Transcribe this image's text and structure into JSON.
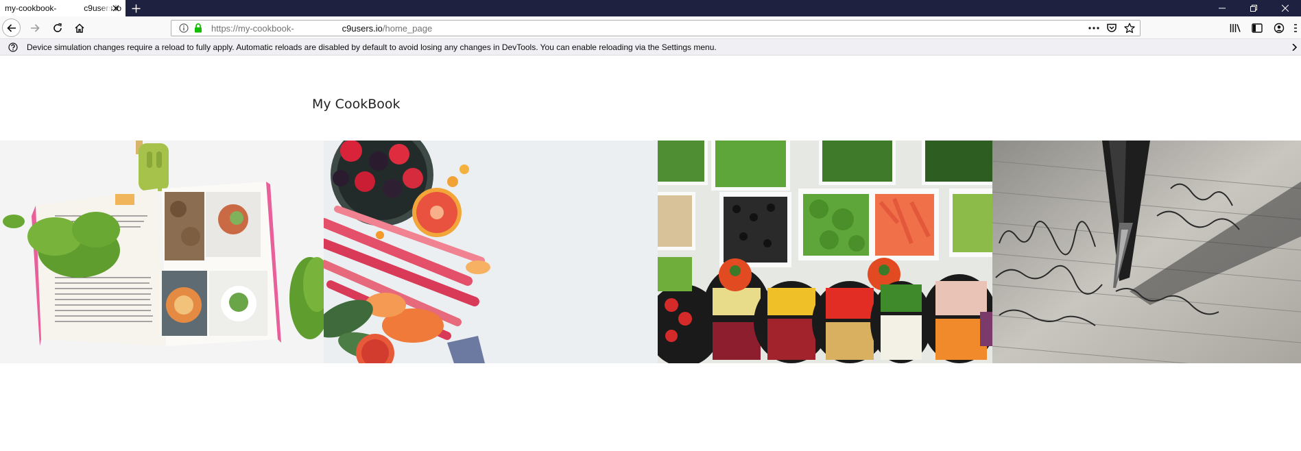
{
  "browser": {
    "tab": {
      "title_prefix": "my-cookbook-",
      "title_suffix": "c9users.io"
    },
    "url": {
      "scheme": "https://my-cookbook-",
      "domain": "c9users.io",
      "path": "/home_page"
    },
    "notification": {
      "message": "Device simulation changes require a reload to fully apply. Automatic reloads are disabled by default to avoid losing any changes in DevTools. You can enable reloading via the Settings menu."
    },
    "colors": {
      "tabstrip": "#1f2140",
      "lock_green": "#12bc00",
      "notification_bg": "#f0f0f4"
    }
  },
  "page": {
    "site_title": "My CookBook",
    "gallery": [
      {
        "name": "open-cookbook-photo"
      },
      {
        "name": "fruit-rhubarb-photo"
      },
      {
        "name": "vegetable-buffet-photo"
      },
      {
        "name": "fountain-pen-writing-photo"
      }
    ]
  }
}
